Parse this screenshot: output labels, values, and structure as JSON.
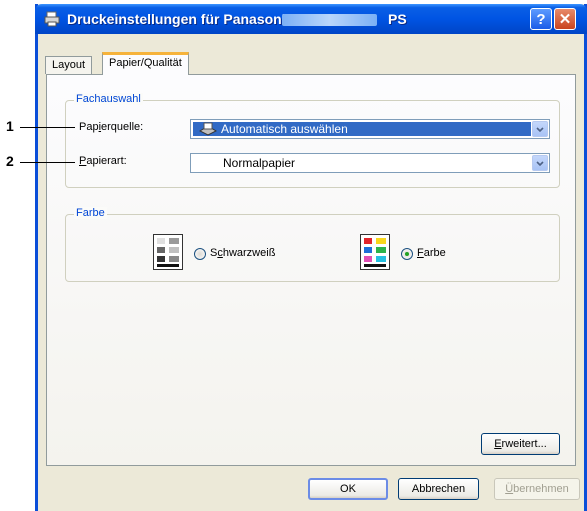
{
  "window": {
    "title": "Druckeinstellungen für Panasonic",
    "title_suffix": "PS",
    "help_label": "?",
    "close_label": "✕"
  },
  "tabs": [
    {
      "label": "Layout",
      "active": false
    },
    {
      "label": "Papier/Qualität",
      "active": true
    }
  ],
  "fachauswahl": {
    "legend": "Fachauswahl",
    "source": {
      "label_pre": "Pap",
      "label_u": "i",
      "label_post": "erquelle:",
      "value": "Automatisch auswählen"
    },
    "type": {
      "label_pre": "",
      "label_u": "P",
      "label_post": "apierart:",
      "value": "Normalpapier"
    }
  },
  "farbe": {
    "legend": "Farbe",
    "bw": {
      "label_pre": "S",
      "label_u": "c",
      "label_post": "hwarzweiß",
      "selected": false
    },
    "color": {
      "label_pre": "",
      "label_u": "F",
      "label_post": "arbe",
      "selected": true
    }
  },
  "callouts": {
    "one": "1",
    "two": "2"
  },
  "buttons": {
    "advanced": {
      "pre": "",
      "u": "E",
      "post": "rweitert..."
    },
    "ok": "OK",
    "cancel": "Abbrechen",
    "apply": {
      "pre": "",
      "u": "Ü",
      "post": "bernehmen"
    }
  },
  "icons": {
    "app": "printer-icon",
    "source": "paper-tray-icon",
    "bw": "grayscale-palette-icon",
    "color": "color-palette-icon"
  },
  "colors": {
    "title_bar": "#0054e3",
    "accent": "#f6b33b",
    "selection": "#316ac5"
  }
}
